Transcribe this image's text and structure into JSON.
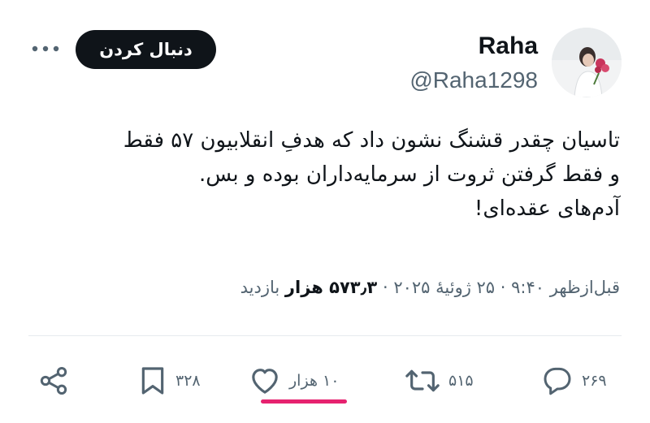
{
  "user": {
    "display_name": "Raha",
    "handle": "@Raha1298",
    "avatar_icon": "profile-photo"
  },
  "follow_button": {
    "label": "دنبال کردن"
  },
  "more_icon": "more-horizontal-icon",
  "tweet": {
    "text": "تاسیان چقدر قشنگ نشون داد که هدفِ انقلابیون ۵۷ فقط\nو فقط گرفتن ثروت از سرمایه‌داران بوده و بس.\nآدم‌های عقده‌ای!"
  },
  "meta": {
    "time": "قبل‌ازظهر ۹:۴۰",
    "date": "۲۵ ژوئیهٔ ۲۰۲۵",
    "separator": "·",
    "views_count": "۵۷۳٫۳ هزار",
    "views_label": "بازدید"
  },
  "actions": {
    "reply": {
      "icon": "reply-icon",
      "count": "۲۶۹"
    },
    "retweet": {
      "icon": "retweet-icon",
      "count": "۵۱۵"
    },
    "like": {
      "icon": "heart-icon",
      "count": "۱۰ هزار"
    },
    "bookmark": {
      "icon": "bookmark-icon",
      "count": "۳۲۸"
    },
    "share": {
      "icon": "share-icon"
    }
  },
  "colors": {
    "text": "#0f1419",
    "secondary": "#536471",
    "follow_bg": "#0f1419",
    "highlight": "#e6226f"
  }
}
